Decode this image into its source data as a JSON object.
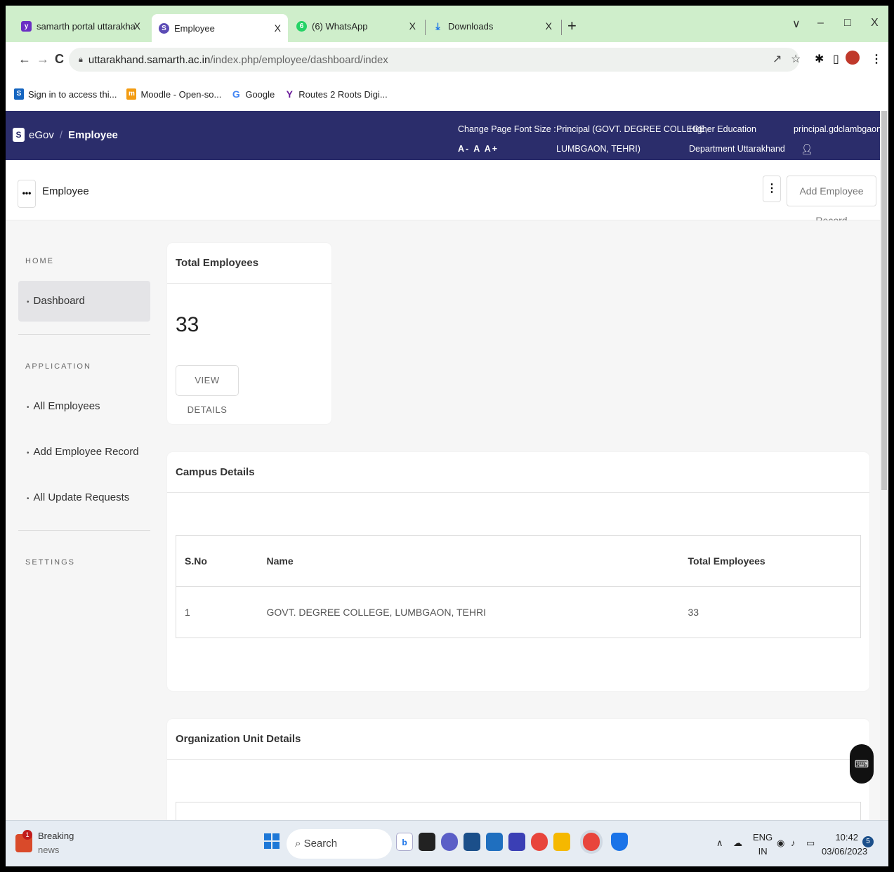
{
  "browser": {
    "tabs": [
      {
        "title": "samarth portal uttarakhand - Yah",
        "close": "X"
      },
      {
        "title": "Employee",
        "close": "X"
      },
      {
        "title": "(6) WhatsApp",
        "close": "X"
      },
      {
        "title": "Downloads",
        "close": "X"
      }
    ],
    "new_tab": "+",
    "window_controls": {
      "dropdown": "∨",
      "minimize": "–",
      "restore": "□",
      "close": "X"
    },
    "nav": {
      "back": "←",
      "forward": "→",
      "reload": "C"
    },
    "url": {
      "host": "uttarakhand.samarth.ac.in",
      "path": "/index.php/employee/dashboard/index"
    },
    "bookmarks": [
      {
        "label": "Sign in to access thi...",
        "icon": "S"
      },
      {
        "label": "Moodle - Open-so...",
        "icon": "m"
      },
      {
        "label": "Google",
        "icon": "G"
      },
      {
        "label": "Routes 2 Roots Digi...",
        "icon": "Y"
      }
    ]
  },
  "header": {
    "brand": "eGov",
    "brand_logo": "S",
    "module": "Employee",
    "font_size_label": "Change Page Font Size :",
    "font_size_options": "A- A A+",
    "role_line1": "Principal (GOVT. DEGREE COLLEGE,",
    "role_line2": "LUMBGAON, TEHRI)",
    "dept_line1": "Higher Education",
    "dept_line2": "Department Uttarakhand",
    "username": "principal.gdclambgaon",
    "user_icon": "♀"
  },
  "toolbar": {
    "menu_dots": "•••",
    "title": "Employee",
    "kebab": "⋮",
    "add_record_label": "Add Employee Record"
  },
  "sidebar": {
    "home_label": "HOME",
    "dashboard": "Dashboard",
    "application_label": "APPLICATION",
    "items": [
      "All Employees",
      "Add Employee Record",
      "All Update Requests"
    ],
    "settings_label": "SETTINGS"
  },
  "total_card": {
    "title": "Total Employees",
    "count": "33",
    "button": "VIEW DETAILS"
  },
  "campus": {
    "title": "Campus Details",
    "columns": [
      "S.No",
      "Name",
      "Total Employees"
    ],
    "rows": [
      [
        "1",
        "GOVT. DEGREE COLLEGE, LUMBGAON, TEHRI",
        "33"
      ]
    ]
  },
  "org": {
    "title": "Organization Unit Details"
  },
  "taskbar": {
    "news_line1": "Breaking",
    "news_line2": "news",
    "news_badge": "1",
    "search": "Search",
    "lang1": "ENG",
    "lang2": "IN",
    "time": "10:42",
    "date": "03/06/2023",
    "notif": "5"
  },
  "colors": {
    "header_bg": "#2b2d6b",
    "tabstrip_bg": "#cfeecb",
    "page_bg": "#f6f6f6"
  }
}
